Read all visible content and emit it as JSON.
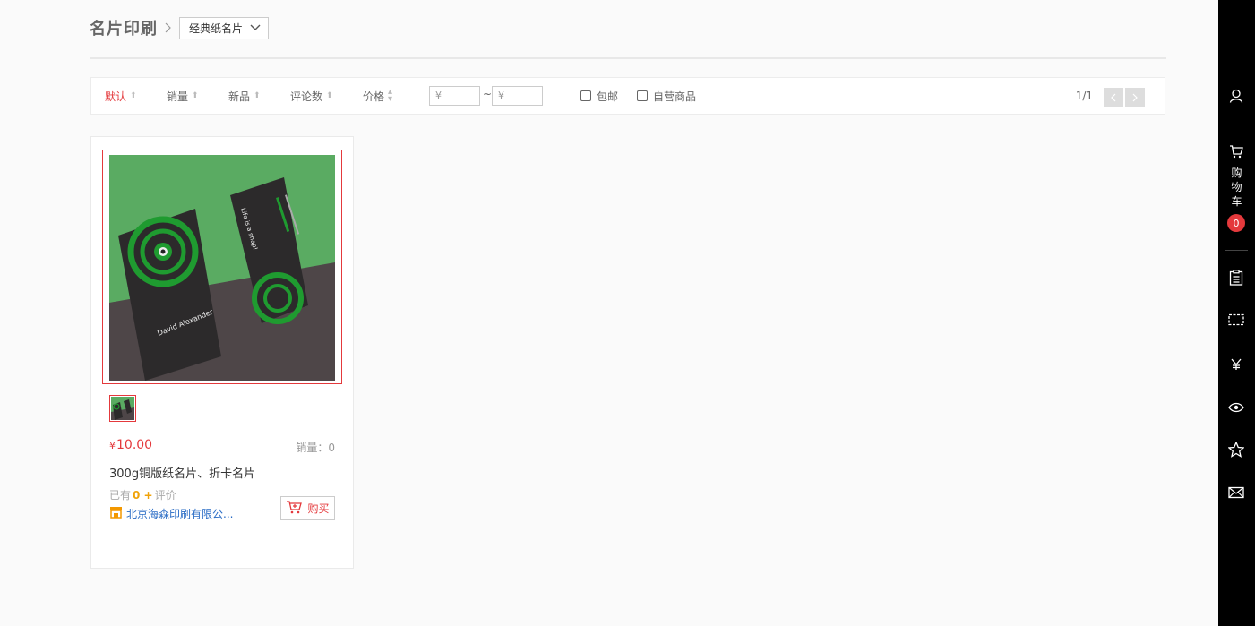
{
  "breadcrumb": {
    "title": "名片印刷",
    "select_value": "经典纸名片"
  },
  "filter": {
    "sorts": [
      {
        "label": "默认",
        "active": true
      },
      {
        "label": "销量",
        "active": false
      },
      {
        "label": "新品",
        "active": false
      },
      {
        "label": "评论数",
        "active": false
      },
      {
        "label": "价格",
        "active": false
      }
    ],
    "price_min_placeholder": "¥",
    "price_max_placeholder": "¥",
    "price_separator": "~",
    "checkboxes": [
      {
        "label": "包邮",
        "checked": false
      },
      {
        "label": "自营商品",
        "checked": false
      }
    ],
    "page_indicator": "1/1"
  },
  "products": [
    {
      "price_symbol": "¥",
      "price": "10.00",
      "sales_label": "销量：0",
      "title": "300g铜版纸名片、折卡名片",
      "reviews_prefix": "已有",
      "reviews_count": "0 +",
      "reviews_suffix": "评价",
      "shop_name": "北京海森印刷有限公...",
      "buy_label": "购买"
    }
  ],
  "sidebar": {
    "cart_label": [
      "购",
      "物",
      "车"
    ],
    "cart_count": "0",
    "icons": [
      "user-icon",
      "cart-icon",
      "clipboard-icon",
      "ticket-icon",
      "yen-icon",
      "eye-icon",
      "star-icon",
      "mail-icon"
    ]
  },
  "colors": {
    "accent": "#e4393c",
    "link": "#2a6cc5",
    "sidebar_bg": "#000000",
    "image_green": "#5aab62"
  }
}
